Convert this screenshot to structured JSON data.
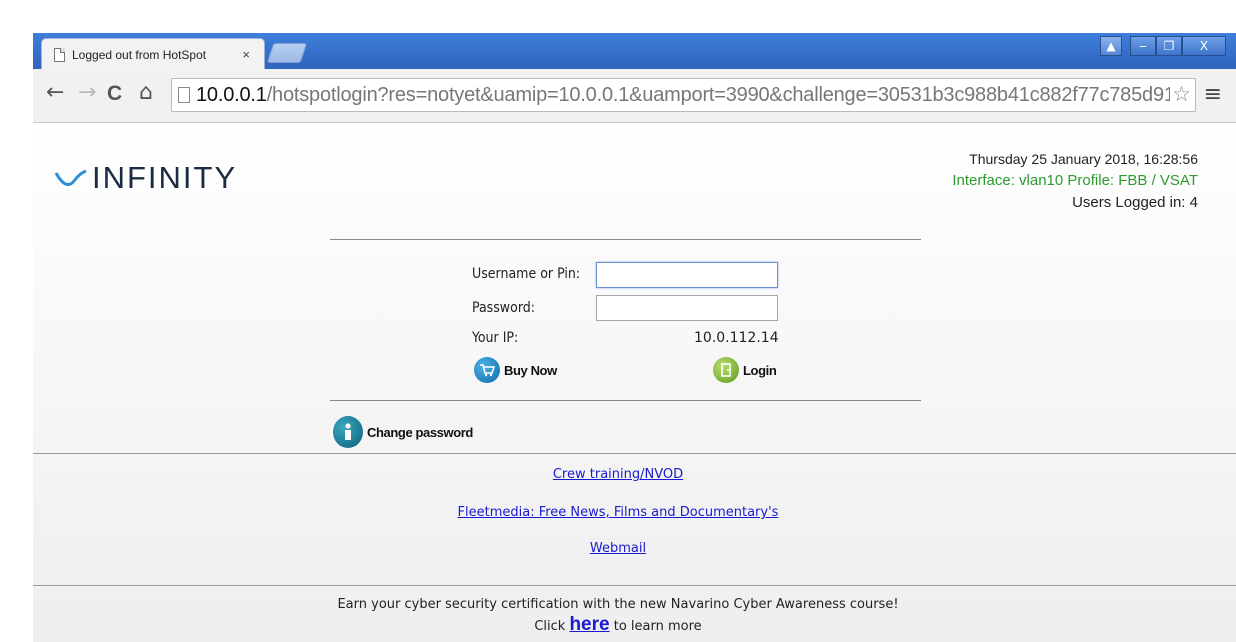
{
  "browser": {
    "tab_title": "Logged out from HotSpot",
    "tab_close": "×",
    "url_host": "10.0.0.1",
    "url_path": "/hotspotlogin?res=notyet&uamip=10.0.0.1&uamport=3990&challenge=30531b3c988b41c882f77c785d91!",
    "back": "←",
    "forward": "→",
    "reload": "C",
    "home": "⌂",
    "star": "☆",
    "menu": "≡",
    "win_user": "▲",
    "win_min": "‒",
    "win_max": "❐",
    "win_close": "X"
  },
  "header": {
    "logo_text": "INFINITY",
    "datetime": "Thursday 25 January 2018, 16:28:56",
    "interface": "Interface: vlan10 Profile: FBB / VSAT",
    "users": "Users Logged in: 4"
  },
  "login_form": {
    "username_label": "Username or Pin:",
    "username_value": "",
    "password_label": "Password:",
    "password_value": "",
    "ip_label": "Your IP:",
    "ip_value": "10.0.112.14",
    "buy_now": "Buy Now",
    "login": "Login",
    "change_password": "Change password"
  },
  "links": {
    "crew_training": "Crew training/NVOD",
    "fleetmedia": "Fleetmedia: Free News, Films and Documentary's",
    "webmail": "Webmail"
  },
  "footer": {
    "promo": "Earn your cyber security certification with the new Navarino Cyber Awareness course!",
    "click": "Click",
    "here": "here",
    "learn_more": "to learn more"
  },
  "colors": {
    "chrome_blue": "#3f7fd9",
    "interface_green": "#2e9a2e",
    "link_blue": "#1a1ad0"
  }
}
